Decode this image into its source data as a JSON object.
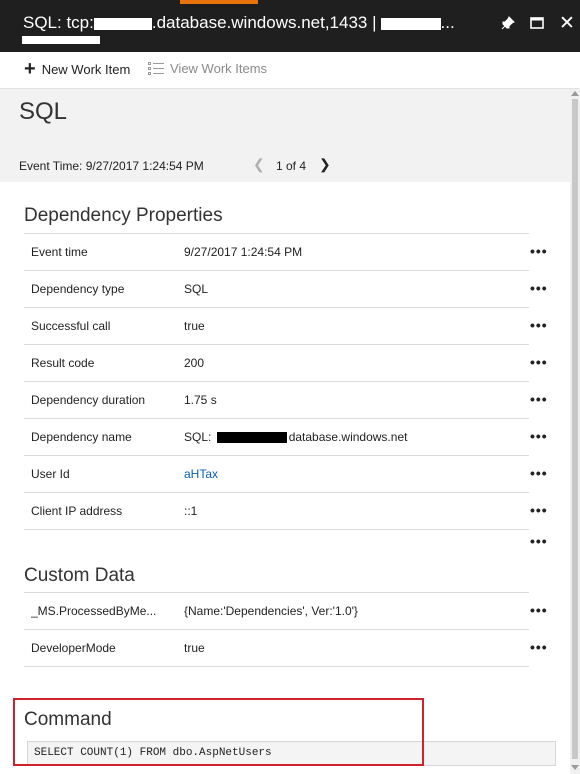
{
  "window": {
    "title_prefix": "SQL: tcp:",
    "title_middle": ".database.windows.net,1433 |",
    "title_suffix": "...",
    "pin_icon": "pin-icon",
    "maximize_icon": "maximize-icon",
    "close_icon": "close-icon",
    "accent_color": "#e8720c"
  },
  "toolbar": {
    "new_work_item": "New Work Item",
    "view_work_items": "View Work Items"
  },
  "header": {
    "title": "SQL",
    "event_time": "Event Time: 9/27/2017 1:24:54 PM",
    "pager": "1 of 4"
  },
  "dependency_properties": {
    "title": "Dependency Properties",
    "rows": [
      {
        "key": "Event time",
        "value": "9/27/2017 1:24:54 PM"
      },
      {
        "key": "Dependency type",
        "value": "SQL"
      },
      {
        "key": "Successful call",
        "value": "true"
      },
      {
        "key": "Result code",
        "value": "200"
      },
      {
        "key": "Dependency duration",
        "value": "1.75 s"
      },
      {
        "key": "Dependency name",
        "value_prefix": "SQL:",
        "value_suffix": "database.windows.net"
      },
      {
        "key": "User Id",
        "value": "aHTax"
      },
      {
        "key": "Client IP address",
        "value": "::1"
      }
    ]
  },
  "custom_data": {
    "title": "Custom Data",
    "rows": [
      {
        "key": "_MS.ProcessedByMe...",
        "value": "{Name:'Dependencies', Ver:'1.0'}"
      },
      {
        "key": "DeveloperMode",
        "value": "true"
      }
    ]
  },
  "command": {
    "title": "Command",
    "text": "SELECT COUNT(1) FROM dbo.AspNetUsers"
  },
  "more_label": "•••",
  "colors": {
    "highlight_border": "#d0212f",
    "link": "#0a5fb4"
  }
}
